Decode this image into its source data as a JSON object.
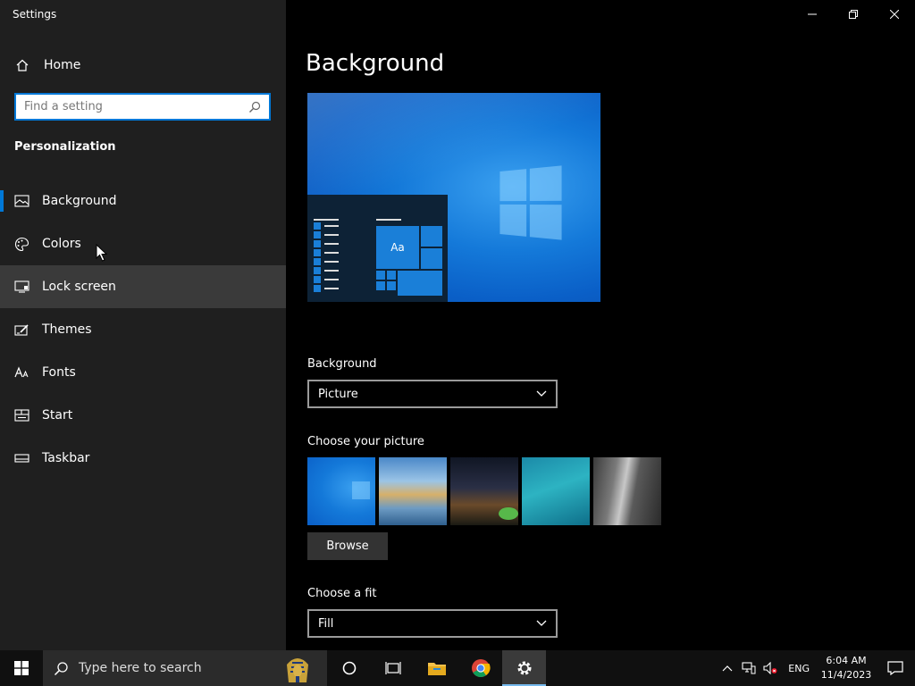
{
  "window": {
    "title": "Settings"
  },
  "sidebar": {
    "home_label": "Home",
    "search_placeholder": "Find a setting",
    "section_title": "Personalization",
    "items": [
      {
        "label": "Background",
        "icon": "picture-icon",
        "selected": true
      },
      {
        "label": "Colors",
        "icon": "palette-icon"
      },
      {
        "label": "Lock screen",
        "icon": "lock-screen-icon",
        "hover": true
      },
      {
        "label": "Themes",
        "icon": "themes-icon"
      },
      {
        "label": "Fonts",
        "icon": "fonts-icon"
      },
      {
        "label": "Start",
        "icon": "start-icon"
      },
      {
        "label": "Taskbar",
        "icon": "taskbar-icon"
      }
    ]
  },
  "main": {
    "title": "Background",
    "preview": {
      "tile_text": "Aa"
    },
    "background_label": "Background",
    "background_value": "Picture",
    "choose_picture_label": "Choose your picture",
    "browse_label": "Browse",
    "choose_fit_label": "Choose a fit",
    "fit_value": "Fill"
  },
  "taskbar": {
    "search_placeholder": "Type here to search",
    "language": "ENG",
    "time": "6:04 AM",
    "date": "11/4/2023"
  },
  "colors": {
    "accent": "#0078d7",
    "sidebar_bg": "#1f1f1f",
    "main_bg": "#000000",
    "taskbar_bg": "#101010"
  }
}
